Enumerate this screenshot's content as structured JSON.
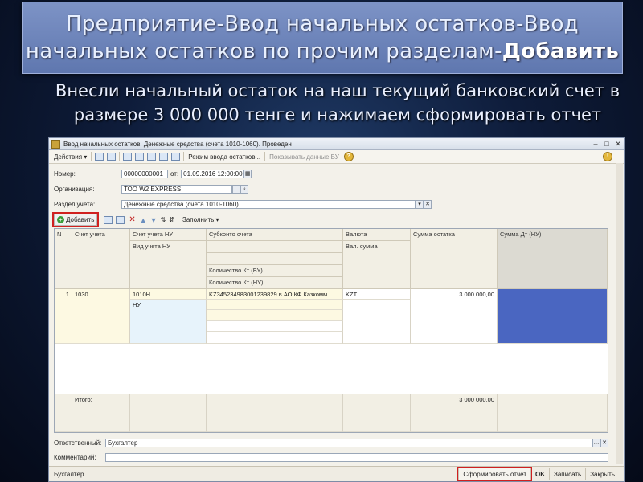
{
  "slide": {
    "title_line1": "Предприятие-Ввод начальных остатков-Ввод",
    "title_line2_prefix": "начальных остатков по прочим разделам-",
    "title_line2_bold": "Добавить",
    "subtitle_line1": "Внесли начальный остаток на наш текущий банковский счет в",
    "subtitle_line2": "размере 3 000 000 тенге и нажимаем сформировать отчет"
  },
  "window": {
    "title": "Ввод начальных остатков: Денежные средства (счета 1010-1060). Проведен",
    "toolbar": {
      "actions": "Действия ▾",
      "mode_entry": "Режим ввода остатков...",
      "show_bu": "Показывать данные БУ"
    },
    "form": {
      "number_label": "Номер:",
      "number_value": "00000000001",
      "date_label": "от:",
      "date_value": "01.09.2016 12:00:00",
      "org_label": "Организация:",
      "org_value": "ТОО W2 EXPRESS",
      "section_label": "Раздел учета:",
      "section_value": "Денежные средства (счета 1010-1060)"
    },
    "table_toolbar": {
      "add": "Добавить",
      "fill": "Заполнить ▾"
    },
    "table": {
      "headers": {
        "n": "N",
        "account": "Счет учета",
        "account_nu": "Счет учета НУ",
        "account_nu_type": "Вид учета НУ",
        "subconto": "Субконто счета",
        "qty_bu": "Количество Кт (БУ)",
        "qty_nu": "Количество Кт (НУ)",
        "currency": "Валюта",
        "currency_sum": "Вал. сумма",
        "balance": "Сумма остатка",
        "sum_dt": "Сумма Дт (НУ)"
      },
      "rows": [
        {
          "n": "1",
          "account": "1030",
          "account_nu": "1010Н",
          "account_nu_type": "НУ",
          "subconto": "KZ345234983001239829 в АО КФ Казкомм...",
          "currency": "KZT",
          "balance": "3 000 000,00"
        }
      ],
      "total_label": "Итого:",
      "total_value": "3 000 000,00"
    },
    "responsible_label": "Ответственный:",
    "responsible_value": "Бухгалтер",
    "comment_label": "Комментарий:",
    "comment_value": "",
    "status_user": "Бухгалтер",
    "buttons": {
      "report": "Сформировать отчет",
      "ok": "OK",
      "save": "Записать",
      "close": "Закрыть"
    }
  },
  "colors": {
    "highlight": "#d02020",
    "selected_cell": "#4a66c1"
  }
}
